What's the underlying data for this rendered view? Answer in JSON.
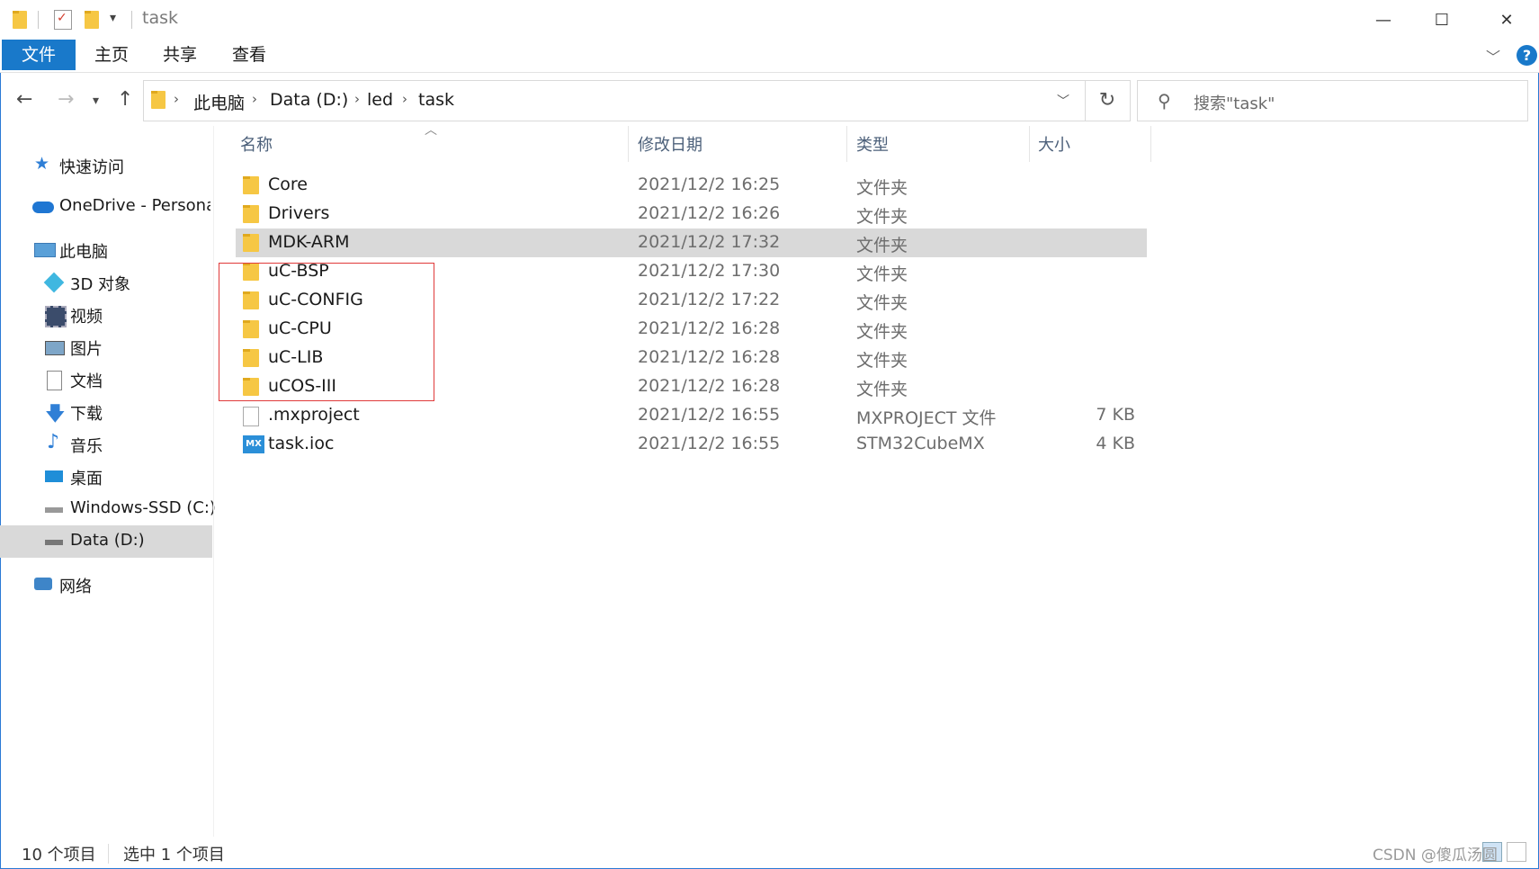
{
  "window": {
    "title": "task"
  },
  "ribbon": {
    "tabs": [
      "文件",
      "主页",
      "共享",
      "查看"
    ]
  },
  "address": {
    "segments": [
      "此电脑",
      "Data (D:)",
      "led",
      "task"
    ]
  },
  "search": {
    "placeholder": "搜索\"task\""
  },
  "nav": {
    "items": [
      {
        "label": "快速访问",
        "icon": "star-icon"
      },
      {
        "label": "OneDrive - Personal",
        "icon": "cloud-icon"
      },
      {
        "label": "此电脑",
        "icon": "computer-icon"
      },
      {
        "label": "3D 对象",
        "icon": "cube-icon"
      },
      {
        "label": "视频",
        "icon": "video-icon"
      },
      {
        "label": "图片",
        "icon": "picture-icon"
      },
      {
        "label": "文档",
        "icon": "document-icon"
      },
      {
        "label": "下载",
        "icon": "download-icon"
      },
      {
        "label": "音乐",
        "icon": "music-icon"
      },
      {
        "label": "桌面",
        "icon": "desktop-icon"
      },
      {
        "label": "Windows-SSD (C:)",
        "icon": "drive-icon"
      },
      {
        "label": "Data (D:)",
        "icon": "drive-icon"
      },
      {
        "label": "网络",
        "icon": "network-icon"
      }
    ]
  },
  "columns": {
    "name": "名称",
    "date": "修改日期",
    "type": "类型",
    "size": "大小"
  },
  "files": [
    {
      "name": "Core",
      "date": "2021/12/2 16:25",
      "type": "文件夹",
      "size": "",
      "icon": "folder-icon"
    },
    {
      "name": "Drivers",
      "date": "2021/12/2 16:26",
      "type": "文件夹",
      "size": "",
      "icon": "folder-icon"
    },
    {
      "name": "MDK-ARM",
      "date": "2021/12/2 17:32",
      "type": "文件夹",
      "size": "",
      "icon": "folder-icon"
    },
    {
      "name": "uC-BSP",
      "date": "2021/12/2 17:30",
      "type": "文件夹",
      "size": "",
      "icon": "folder-icon"
    },
    {
      "name": "uC-CONFIG",
      "date": "2021/12/2 17:22",
      "type": "文件夹",
      "size": "",
      "icon": "folder-icon"
    },
    {
      "name": "uC-CPU",
      "date": "2021/12/2 16:28",
      "type": "文件夹",
      "size": "",
      "icon": "folder-icon"
    },
    {
      "name": "uC-LIB",
      "date": "2021/12/2 16:28",
      "type": "文件夹",
      "size": "",
      "icon": "folder-icon"
    },
    {
      "name": "uCOS-III",
      "date": "2021/12/2 16:28",
      "type": "文件夹",
      "size": "",
      "icon": "folder-icon"
    },
    {
      "name": ".mxproject",
      "date": "2021/12/2 16:55",
      "type": "MXPROJECT 文件",
      "size": "7 KB",
      "icon": "file-icon"
    },
    {
      "name": "task.ioc",
      "date": "2021/12/2 16:55",
      "type": "STM32CubeMX",
      "size": "4 KB",
      "icon": "mx-icon",
      "icon_text": "MX"
    }
  ],
  "status": {
    "count": "10 个项目",
    "selected": "选中 1 个项目"
  },
  "watermark": "CSDN @傻瓜汤圆"
}
